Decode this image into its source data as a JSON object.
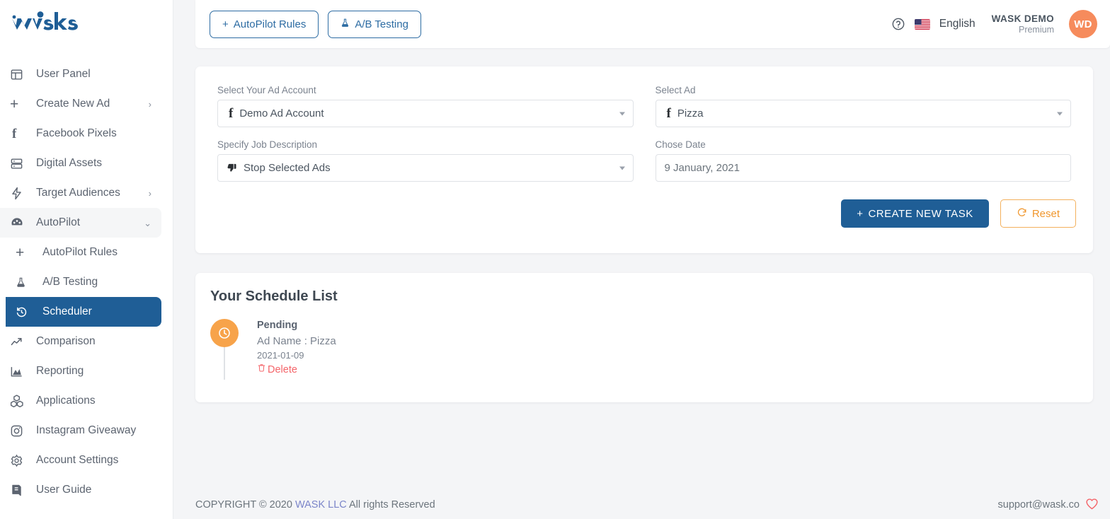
{
  "brand": {
    "logo_text": "wask",
    "logo_color": "#1f5e96"
  },
  "colors": {
    "accent_blue": "#1f5e96",
    "link_blue": "#2d6ca3",
    "orange": "#f7a34a",
    "reset_orange": "#f0972e",
    "delete_red": "#f4656a",
    "avatar_orange": "#f68b5c",
    "page_bg": "#f4f5f7"
  },
  "sidebar": {
    "items": [
      {
        "label": "User Panel",
        "icon": "layout-panel-icon",
        "state": "default",
        "chevron": ""
      },
      {
        "label": "Create New Ad",
        "icon": "plus-icon",
        "state": "default",
        "chevron": "›"
      },
      {
        "label": "Facebook Pixels",
        "icon": "facebook-icon",
        "state": "default",
        "chevron": ""
      },
      {
        "label": "Digital Assets",
        "icon": "server-icon",
        "state": "default",
        "chevron": ""
      },
      {
        "label": "Target Audiences",
        "icon": "bolt-icon",
        "state": "default",
        "chevron": "›"
      },
      {
        "label": "AutoPilot",
        "icon": "speedometer-icon",
        "state": "group-open",
        "chevron": "⌄"
      }
    ],
    "sub_items": [
      {
        "label": "AutoPilot Rules",
        "icon": "plus-icon",
        "state": "default"
      },
      {
        "label": "A/B Testing",
        "icon": "flask-icon",
        "state": "default"
      },
      {
        "label": "Scheduler",
        "icon": "history-clock-icon",
        "state": "active"
      }
    ],
    "items_after": [
      {
        "label": "Comparison",
        "icon": "trend-up-icon",
        "state": "default",
        "chevron": ""
      },
      {
        "label": "Reporting",
        "icon": "area-chart-icon",
        "state": "default",
        "chevron": ""
      },
      {
        "label": "Applications",
        "icon": "blocks-icon",
        "state": "default",
        "chevron": ""
      },
      {
        "label": "Instagram Giveaway",
        "icon": "instagram-icon",
        "state": "default",
        "chevron": ""
      },
      {
        "label": "Account Settings",
        "icon": "gear-icon",
        "state": "default",
        "chevron": ""
      },
      {
        "label": "User Guide",
        "icon": "book-icon",
        "state": "default",
        "chevron": ""
      }
    ]
  },
  "topbar": {
    "autopilot_rules_label": "AutoPilot Rules",
    "autopilot_rules_prefix": "+",
    "ab_testing_label": "A/B Testing",
    "help_icon": "question-circle-icon",
    "flag_icon": "us-flag-icon",
    "language": "English",
    "account_name": "WASK DEMO",
    "account_plan": "Premium",
    "avatar_initials": "WD"
  },
  "form": {
    "fields": [
      {
        "label": "Select Your Ad Account",
        "value": "Demo Ad Account",
        "icon": "facebook-icon",
        "type": "select"
      },
      {
        "label": "Select Ad",
        "value": "Pizza",
        "icon": "facebook-icon",
        "type": "select"
      },
      {
        "label": "Specify Job Description",
        "value": "Stop Selected Ads",
        "icon": "thumbs-down-icon",
        "type": "select"
      },
      {
        "label": "Chose Date",
        "value": "9 January, 2021",
        "icon": "",
        "type": "text"
      }
    ],
    "create_button_label": "CREATE NEW TASK",
    "create_button_prefix": "+",
    "reset_button_label": "Reset"
  },
  "schedule": {
    "title": "Your Schedule List",
    "items": [
      {
        "status": "Pending",
        "ad_name": "Ad Name : Pizza",
        "date": "2021-01-09",
        "delete_label": "Delete",
        "status_icon": "clock-icon",
        "delete_icon": "trash-icon"
      }
    ]
  },
  "footer": {
    "copyright_prefix": "COPYRIGHT © 2020",
    "company_link": "WASK LLC",
    "copyright_suffix": "All rights Reserved",
    "support_email": "support@wask.co",
    "heart_icon": "heart-icon"
  }
}
